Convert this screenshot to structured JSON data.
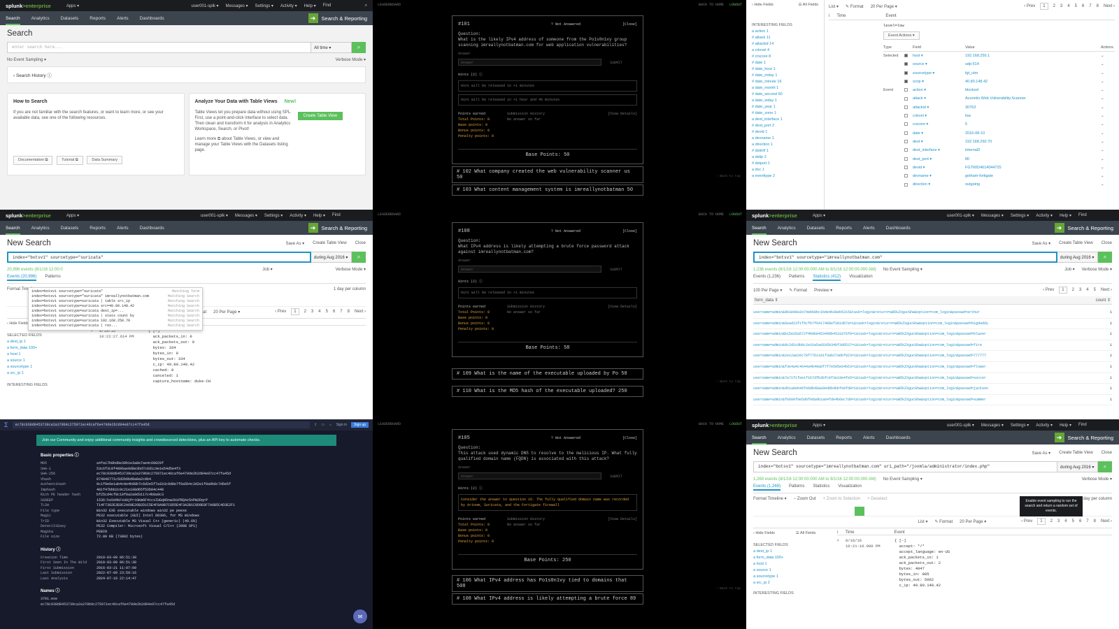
{
  "splunk": {
    "logo_a": "splunk",
    "logo_b": ">enterprise",
    "apps": "Apps ▾",
    "user": "user001-splk ▾",
    "messages": "Messages ▾",
    "settings": "Settings ▾",
    "activity": "Activity ▾",
    "help": "Help ▾",
    "find": "Find",
    "nav": [
      "Search",
      "Analytics",
      "Datasets",
      "Reports",
      "Alerts",
      "Dashboards"
    ],
    "app_name": "Search & Reporting",
    "save_as": "Save As ▾",
    "create_table": "Create Table View",
    "close": "Close",
    "verbose": "Verbose Mode ▾",
    "job": "Job ▾",
    "format_timeline": "Format Timeline ▾",
    "zoom_out": "− Zoom Out",
    "zoom_sel": "+ Zoom to Selection",
    "deselect": "× Deselect",
    "per_column": "1 day per column",
    "list": "List ▾",
    "format": "✎ Format",
    "per_page": "20 Per Page ▾",
    "prev": "‹ Prev",
    "next": "Next ›",
    "pages": [
      "1",
      "2",
      "3",
      "4",
      "5",
      "6",
      "7",
      "8",
      "..."
    ],
    "hide_fields": "‹ Hide Fields",
    "all_fields": "☰ All Fields",
    "col_time": "Time",
    "col_event": "Event",
    "selected_fields": "SELECTED FIELDS",
    "interesting_fields": "INTERESTING FIELDS"
  },
  "p1": {
    "title": "Search",
    "placeholder": "enter search here...",
    "range": "All time ▾",
    "sampling": "No Event Sampling ▾",
    "history": "› Search History ⓘ",
    "how_title": "How to Search",
    "how_text": "If you are not familiar with the search features, or want to learn more, or see your available data, see one of the following resources.",
    "btn_doc": "Documentation ⧉",
    "btn_tut": "Tutorial ⧉",
    "btn_ds": "Data Summary",
    "an_title": "Analyze Your Data with Table Views",
    "an_new": "New!",
    "an_text": "Table Views let you prepare data without using SPL. First, use a point-and-click interface to select data. Then clean and transform it for analysis in Analytics Workspace, Search, or Pivot!",
    "an_text2": "Learn more ⧉ about Table Views, or view and manage your Table Views with the Datasets listing page.",
    "create_btn": "Create Table View"
  },
  "p4": {
    "title": "New Search",
    "query": "index=\"botsv1\" sourcetype=\"suricata\"",
    "range": "during Aug 2016 ▾",
    "count": "20,996 events (8/1/16 12:00:0",
    "tabs": [
      "Events (20,996)",
      "Patterns"
    ],
    "suggest": [
      [
        "index=botsv1 sourcetype=\"suricata\"",
        "Matching Term"
      ],
      [
        "index=botsv1 sourcetype=\"suricata\" imreallynotbatman.com",
        "Matching Search"
      ],
      [
        "index=botsv1 sourcetype=suricata | table src_ip",
        "Matching Search"
      ],
      [
        "index=botsv1 sourcetype=suricata src=40.80.148.42",
        "Matching Search"
      ],
      [
        "index=botsv1 sourcetype=suricata dest_ip=...",
        "Matching Search"
      ],
      [
        "index=botsv1 sourcetype=suricata | stats count by",
        "Matching Search"
      ],
      [
        "index=botsv1 sourcetype=suricata 192.168.250.70",
        "Matching Search"
      ],
      [
        "index=botsv1 sourcetype=suricata | rex...",
        "Matching Search"
      ]
    ],
    "fields": [
      "a dest_ip 1",
      "a form_data 100+",
      "a host 1",
      "a source 1",
      "a sourcetype 1",
      "a src_ip 1"
    ],
    "time": "8/10/16\n10:22:27.614 PM",
    "event": [
      "{ [-]",
      "  ack_packets_in: 0",
      "  ack_packets_out: 0",
      "  bytes: 334",
      "  bytes_in: 0",
      "  bytes_out: 334",
      "  c_ip: 40.80.148.42",
      "  cached: 0",
      "  canceled: 1",
      "  capture_hostname: duke-CH"
    ]
  },
  "p7": {
    "query": "ec78c938d8453739ca2a370b9c275971ec46caf6e479de2b2d04e97cc47fa45d",
    "signin": "Sign in",
    "signup": "Sign up",
    "banner": "Join our Community and enjoy additional community insights and crowdsourced detections, plus an API key to automate checks.",
    "basic": "Basic properties ⓘ",
    "props": [
      [
        "MD5",
        "a4fa17b8bd8e39b1e3a8e7ae4c60829f"
      ],
      [
        "SHA-1",
        "53c6f3c0f4896ae9d8e3bd7c6d1c9e1e54d5e4f3"
      ],
      [
        "SHA-256",
        "ec78c938d8453739ca2a370b9c275971ec46caf6e479de2b2d04e97cc47fa45d"
      ],
      [
        "Vhash",
        "074046771c5d2b6bd0a0a2c0b4"
      ],
      [
        "Authentihash",
        "0c1f9e6e1ab4c0e4b98b7c6d2e5f7a1b3c9d8e7f6a5b4c3d2e1f0a9b8c7d6e5f"
      ],
      [
        "Imphash",
        "481f47bbb2c9c21e108d65f52b04c448"
      ],
      [
        "Rich PE header hash",
        "bf25cd4cf8c10f0a2a9d3117c4b8a9c3"
      ],
      [
        "SSDEEP",
        "1536:hs5d4kFxU0jPrtGKm6F4tcxIUGqN5nw2HiPRQ4z5nPW2DqrP"
      ],
      [
        "TLSH",
        "T14F7382E3E0C2A69E26B2D1C5E4F8A9B7C6D5E4F3A2B1C0D9E8F7A6B5C4D3E2F1"
      ],
      [
        "File type",
        "Win32 EXE  executable  windows  win32  pe  peexe"
      ],
      [
        "Magic",
        "PE32 executable (GUI) Intel 80386, for MS Windows"
      ],
      [
        "TrID",
        "Win32 Executable MS Visual C++ (generic) (49.6%)"
      ],
      [
        "DetectItEasy",
        "PE32  Compiler: Microsoft Visual C/C++ (2008 SP1)"
      ],
      [
        "Magika",
        "PEBIN"
      ],
      [
        "File size",
        "72.00 KB (73802 bytes)"
      ]
    ],
    "history": "History ⓘ",
    "hist": [
      [
        "Creation Time",
        "2010-03-09 06:51:30"
      ],
      [
        "First Seen In The Wild",
        "2010-03-09 06:51:30"
      ],
      [
        "First Submission",
        "2016-03-21 11:07:09"
      ],
      [
        "Last Submission",
        "2022-07-09 23:59:16"
      ],
      [
        "Last Analysis",
        "2024-07-19 22:14:47"
      ]
    ],
    "names": "Names ⓘ",
    "name1": "3791.exe",
    "name2": "ec78c938d8453739ca2a370b9c275971ec46caf6e479de2b2d04e97cc47fa45d"
  },
  "ctf": {
    "top_left": "LEADERBOARD",
    "back": "BACK TO HOME",
    "logout": "LOGOUT",
    "not_answered": "? Not Answered",
    "close": "[Close]",
    "question": "Question:",
    "answer": "Answer",
    "submit": "SUBMIT",
    "hints": "Hints (2) ⓘ",
    "points": "Points earned",
    "history": "Submission History",
    "view_details": "[View Details]",
    "no_answer": "No answer so far",
    "total": "Total Points:",
    "base": "Base points:",
    "bonus": "Bonus points:",
    "penalty": "Penalty points:",
    "zero": "0",
    "backtop": "↑ Back to top",
    "c2": {
      "id": "#101",
      "q": "What is the likely IPv4 address of someone from the Po1s0n1vy group scanning imreallynotbatman.com for web application vulnerabilities?",
      "h1": "Hint will be released in +1 minutes",
      "h2": "Hint will be released in +1 hour and 40 minutes",
      "base_pts": "Base Points: 50",
      "rows": [
        "# 102 What company created the web vulnerability scanner us 50",
        "# 103 What content management system is imreallynotbatman 50"
      ]
    },
    "c5": {
      "id": "#108",
      "q": "What IPv4 address is likely attempting a brute force password attack against imreallynotbatman.com?",
      "h1": "Hint will be released in +1 minutes",
      "base_pts": "Base Points: 58",
      "rows": [
        "# 109 What is the name of the executable uploaded by Po 58",
        "# 110 What is the MD5 hash of the executable uploaded? 250"
      ]
    },
    "c8": {
      "id": "#105",
      "q": "This attack used dynamic DNS to resolve to the malicious IP. What fully qualified domain name (FQDN) is associated with this attack?",
      "h1": "Consider the answer to question 1O. The fully qualified domain name was recorded by Arinom, Suricata, and the Fortigate firewall",
      "base_pts": "Base Points: 250",
      "rows": [
        "# 106 What IPv4 address has Po1s0n1vy tied to domains that 508",
        "# 108 What IPv4 address is likely attempting a brute force 89"
      ]
    }
  },
  "p3": {
    "hide": "‹ Hide Fields",
    "all": "☰ All Fields",
    "list": "List ▾",
    "format": "✎ Format",
    "per_page": "20 Per Page ▾",
    "interesting": "INTERESTING FIELDS",
    "fields": [
      "a action 1",
      "# attack 11",
      "# attackid 14",
      "a crlevel 4",
      "# crscore 8",
      "# date 1",
      "# date_hour 1",
      "# date_mday 1",
      "# date_minute 16",
      "a date_month 1",
      "# date_second 60",
      "a date_wday 1",
      "# date_year 1",
      "# date_zone 1",
      "a dest_interface 1",
      "# dest_port 2",
      "# devid 1",
      "a devname 1",
      "a direction 1",
      "# dstintf 1",
      "a dstip 2",
      "# dstport 1",
      "a dvc 1",
      "a eventtype 2"
    ],
    "ev_head": "level=low",
    "ev_actions": "Event Actions ▾",
    "h_type": "Type",
    "h_field": "Field",
    "h_value": "Value",
    "h_actions": "Actions",
    "selected": "Selected",
    "event": "Event",
    "rows": [
      [
        "host ▾",
        "192.168.250.1"
      ],
      [
        "source ▾",
        "udp:514"
      ],
      [
        "sourcetype ▾",
        "fgt_utm"
      ],
      [
        "srcip ▾",
        "40.80.148.42"
      ],
      [
        "action ▾",
        "blocked"
      ],
      [
        "attack ▾",
        "Acunetix.Web.Vulnerability.Scanner"
      ],
      [
        "attackid ▾",
        "30763"
      ],
      [
        "crlevel ▾",
        "low"
      ],
      [
        "crscore ▾",
        "5"
      ],
      [
        "date ▾",
        "2016-08-10"
      ],
      [
        "dest ▾",
        "192.168.250.70"
      ],
      [
        "dest_interface ▾",
        "internal3"
      ],
      [
        "dest_port ▾",
        "80"
      ],
      [
        "devid ▾",
        "FGT60D4614044725"
      ],
      [
        "devname ▾",
        "gotham-fortigate"
      ],
      [
        "direction ▾",
        "outgoing"
      ]
    ]
  },
  "p6": {
    "title": "New Search",
    "query": "index=\"botsv1\" sourcetype=\"imreallynotbatman.com\"",
    "range": "during Aug 2016 ▾",
    "count": "1,236 events (8/1/16 12:00:00.000 AM to 9/1/16 12:00:00.000 AM)",
    "sampling": "No Event Sampling ▾",
    "tabs": [
      "Events (1,236)",
      "Patterns",
      "Statistics (412)",
      "Visualization"
    ],
    "stat_per_page": "100 Per Page ▾",
    "stat_format": "✎ Format",
    "stat_preview": "Preview ▾",
    "col": "form_data ⇕",
    "col_count": "count ⇕",
    "rows": [
      "username=admin&9b3e99a1b74ebb8bc1bde4b38eb5315&task=login&return=aW5kZXgucGhw&option=com_login&passwd=arthur",
      "username=admin&6ead23f1f5cfb7f6417488ef381d87a=1&task=login&return=aW5kZXgucGhw&option=com_login&passwd=bigdaddy",
      "username=admin&b15e26a572f4b0b0453499b4531076f0=1&task=login&return=aW5kZXgucGhw&option=com_login&passwd=blazer",
      "username=admin&9c2d2c9b8c2e16a5ad1b5b348f3d6537=1&task=login&return=aW5kZXgucGhw&option=com_login&passwd=fire",
      "username=admin&2e12ae26c70f7761181f3ab27a6bf823=1&task=login&return=aW5kZXgucGhw&option=com_login&passwd=777777",
      "username=admin&f3e4a4c4644a4b49a8f7f7e595e64b53=1&task=login&return=aW5kZXgucGhw&option=com_login&passwd=flower",
      "username=admin&7e71f1fee1f1b7dfb3bfc8f3e19e4fe5=1&task=login&return=aW5kZXgucGhw&option=com_login&passwd=soccer",
      "username=admin&4b1a8eb46fe9db48ae0ed0b4bbfe0fd8=1&task=login&return=aW5kZXgucGhw&option=com_login&passwd=jackson",
      "username=admin&f6600f0e5d8f9da9b1a64fde4b6ec7d9=1&task=login&return=aW5kZXgucGhw&option=com_login&passwd=summer"
    ],
    "count1": "1"
  },
  "p9": {
    "title": "New Search",
    "query": "index=\"botsv1\" sourcetype=\"imreallynotbatman.com\" uri_path=\"/joomla/administrator/index.php\"",
    "range": "during Aug 2016 ▾",
    "count": "1,269 events (8/1/16 12:00:00.000 AM to 9/1/16 12:00:00.000 AM)",
    "sampling": "No Event Sampling ▾",
    "tooltip": "Enable event sampling to run the search and return a random set of events.",
    "tabs": [
      "Events (1,269)",
      "Patterns",
      "Statistics",
      "Visualization"
    ],
    "fields": [
      "a dest_ip 1",
      "a form_data 100+",
      "a host 1",
      "a source 1",
      "a sourcetype 1",
      "a src_ip 2"
    ],
    "time": "8/10/16\n10:21:10.000 PM",
    "event": [
      "{ [-]",
      "  accept: */*",
      "  accept_language: en-US",
      "  ack_packets_in: 1",
      "  ack_packets_out: 2",
      "  bytes: 4847",
      "  bytes_in: 885",
      "  bytes_out: 5062",
      "  c_ip: 40.80.148.42"
    ]
  }
}
